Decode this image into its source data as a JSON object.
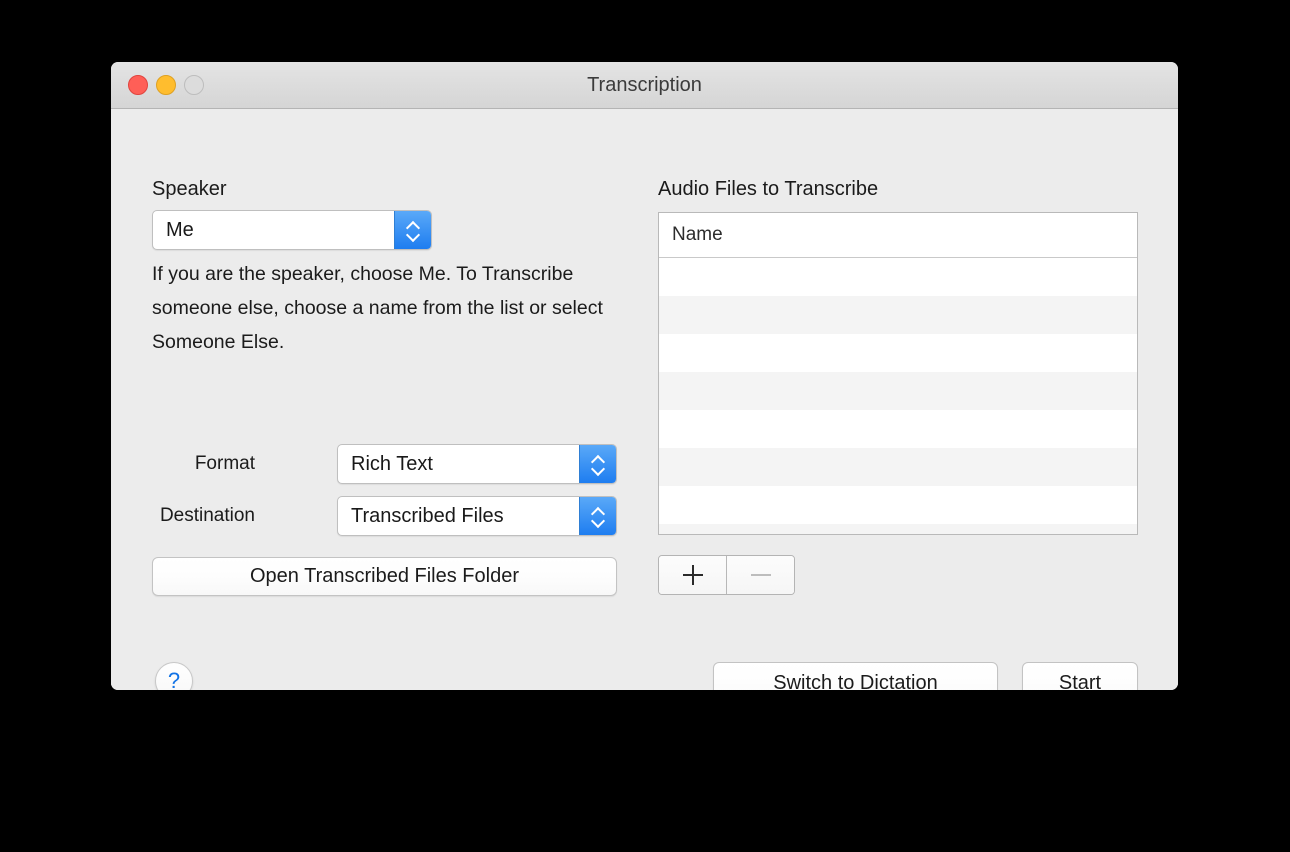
{
  "window": {
    "title": "Transcription",
    "traffic_lights": {
      "close": "close-button",
      "minimize": "minimize-button",
      "zoom": "zoom-button",
      "close_color": "#ff5f57",
      "minimize_color": "#ffbd2e",
      "zoom_color": "#dcdcdc"
    }
  },
  "left_panel": {
    "speaker_label": "Speaker",
    "speaker_value": "Me",
    "help_text": "If you are the speaker, choose Me.  To Transcribe someone else, choose a name from the list or select Someone Else.",
    "format_label": "Format",
    "format_value": "Rich Text",
    "destination_label": "Destination",
    "destination_value": "Transcribed Files",
    "open_folder_button": "Open Transcribed Files Folder",
    "help_button_glyph": "?"
  },
  "right_panel": {
    "section_title": "Audio Files to Transcribe",
    "table": {
      "columns": [
        "Name"
      ],
      "rows": [],
      "empty_row_count": 8
    },
    "add_button_glyph": "+",
    "remove_button_glyph": "—"
  },
  "footer": {
    "switch_button": "Switch to Dictation",
    "start_button": "Start"
  },
  "colors": {
    "window_bg": "#ececec",
    "titlebar_top": "#e4e4e4",
    "titlebar_bottom": "#d5d5d5",
    "accent_blue": "#1e7df0",
    "help_blue": "#1273e6",
    "row_alt": "#f4f4f4"
  }
}
